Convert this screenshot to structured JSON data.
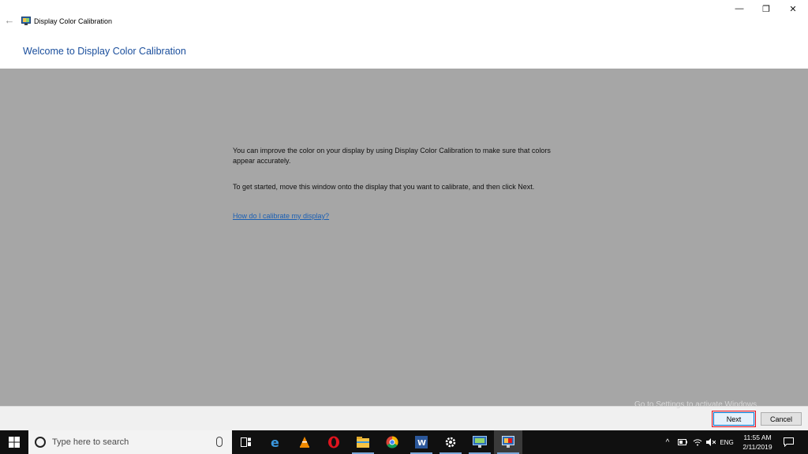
{
  "window": {
    "title": "Display Color Calibration",
    "heading": "Welcome to Display Color Calibration",
    "controls": {
      "minimize": "—",
      "maximize": "❐",
      "close": "✕"
    }
  },
  "content": {
    "paragraph1": "You can improve the color on your display by using Display Color Calibration to make sure that colors appear accurately.",
    "paragraph2": "To get started, move this window onto the display that you want to calibrate, and then click Next.",
    "help_link": "How do I calibrate my display?"
  },
  "buttons": {
    "watermark": "Go to Settings to activate Windows.",
    "next": "Next",
    "cancel": "Cancel"
  },
  "taskbar": {
    "search_placeholder": "Type here to search",
    "apps": [
      "task-view-icon",
      "edge-icon",
      "vlc-icon",
      "opera-icon",
      "file-explorer-icon",
      "chrome-icon",
      "word-icon",
      "settings-icon",
      "display-icon",
      "color-calibration-icon"
    ],
    "language": "ENG",
    "time": "11:55 AM",
    "date": "2/11/2019"
  },
  "colors": {
    "heading": "#1a4e9c",
    "content_bg": "#a6a6a6",
    "link": "#1a5fb4",
    "taskbar": "#101010",
    "next_highlight": "#e81123"
  }
}
